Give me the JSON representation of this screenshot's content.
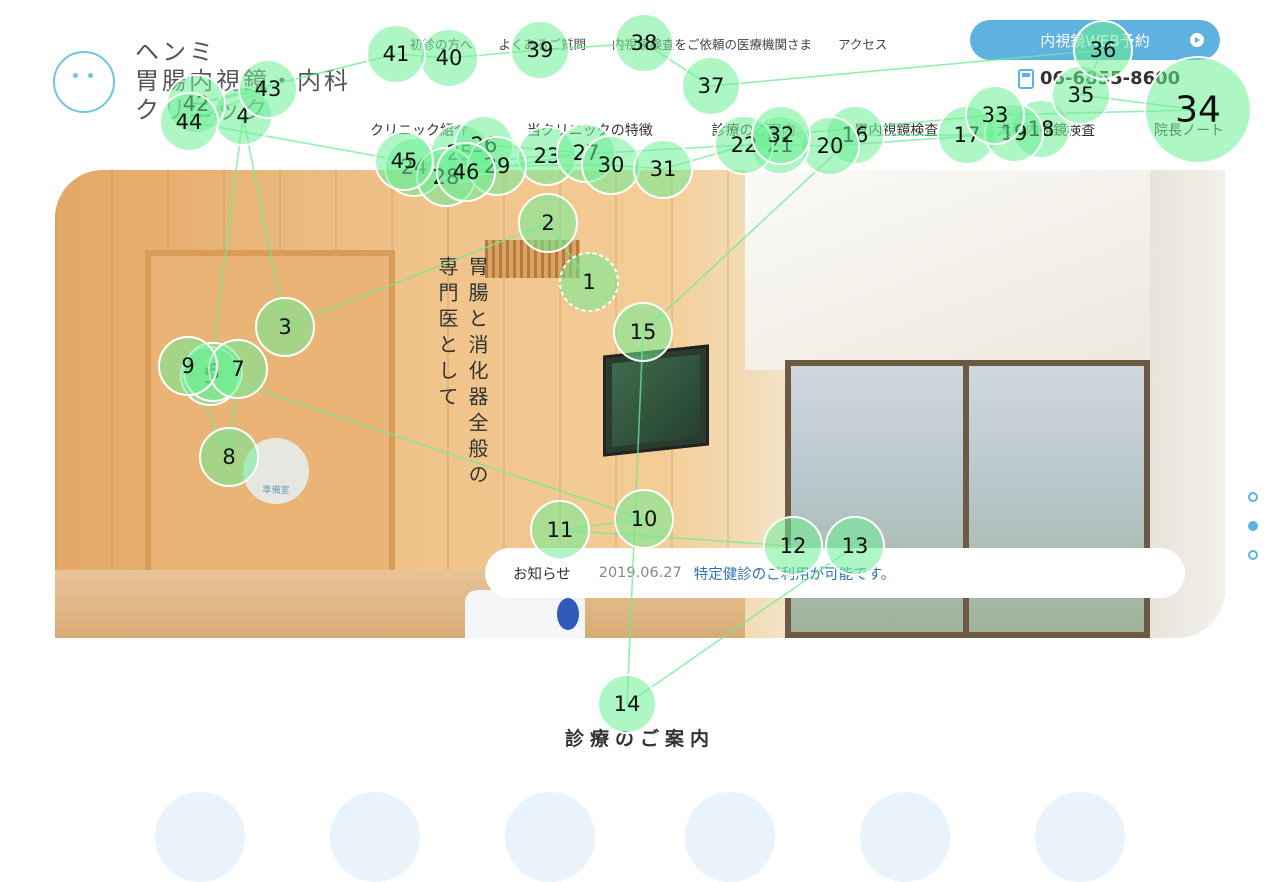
{
  "logo": {
    "line1": "ヘンミ",
    "line2": "胃腸内視鏡・内科",
    "line3": "クリニック"
  },
  "top_nav": [
    "初診の方へ",
    "よくあるご質問",
    "内視鏡検査をご依頼の医療機関さま",
    "アクセス"
  ],
  "reserve_button": "内視鏡WEB予約",
  "phone": "06-6855-8600",
  "main_nav": [
    "クリニック紹介",
    "当クリニックの特徴",
    "診療のご案内",
    "胃内視鏡検査",
    "大腸内視鏡検査",
    "院長ノート"
  ],
  "hero": {
    "copy_col1": "胃腸と消化器全般の",
    "copy_col2": "専門医として",
    "sign": "準備室"
  },
  "news": {
    "label": "お知らせ",
    "date": "2019.06.27",
    "text": "特定健診のご利用が可能です。"
  },
  "slider": {
    "count": 3,
    "active_index": 1
  },
  "section_title": "診療のご案内",
  "colors": {
    "accent": "#5eb1e0",
    "link": "#2d74b5",
    "gaze": "#6eee96"
  },
  "gaze_fixations": [
    {
      "n": "1"
    },
    {
      "n": "2"
    },
    {
      "n": "3"
    },
    {
      "n": "4"
    },
    {
      "n": "5"
    },
    {
      "n": "6"
    },
    {
      "n": "7"
    },
    {
      "n": "8"
    },
    {
      "n": "9"
    },
    {
      "n": "10"
    },
    {
      "n": "11"
    },
    {
      "n": "12"
    },
    {
      "n": "13"
    },
    {
      "n": "14"
    },
    {
      "n": "15"
    },
    {
      "n": "16"
    },
    {
      "n": "17"
    },
    {
      "n": "18"
    },
    {
      "n": "19"
    },
    {
      "n": "20"
    },
    {
      "n": "21"
    },
    {
      "n": "22"
    },
    {
      "n": "23"
    },
    {
      "n": "24"
    },
    {
      "n": "25"
    },
    {
      "n": "26"
    },
    {
      "n": "27"
    },
    {
      "n": "28"
    },
    {
      "n": "29"
    },
    {
      "n": "30"
    },
    {
      "n": "31"
    },
    {
      "n": "32"
    },
    {
      "n": "33"
    },
    {
      "n": "34"
    },
    {
      "n": "35"
    },
    {
      "n": "36"
    },
    {
      "n": "37"
    },
    {
      "n": "38"
    },
    {
      "n": "39"
    },
    {
      "n": "40"
    },
    {
      "n": "41"
    },
    {
      "n": "42"
    },
    {
      "n": "43"
    },
    {
      "n": "44"
    },
    {
      "n": "45"
    },
    {
      "n": "46"
    }
  ]
}
